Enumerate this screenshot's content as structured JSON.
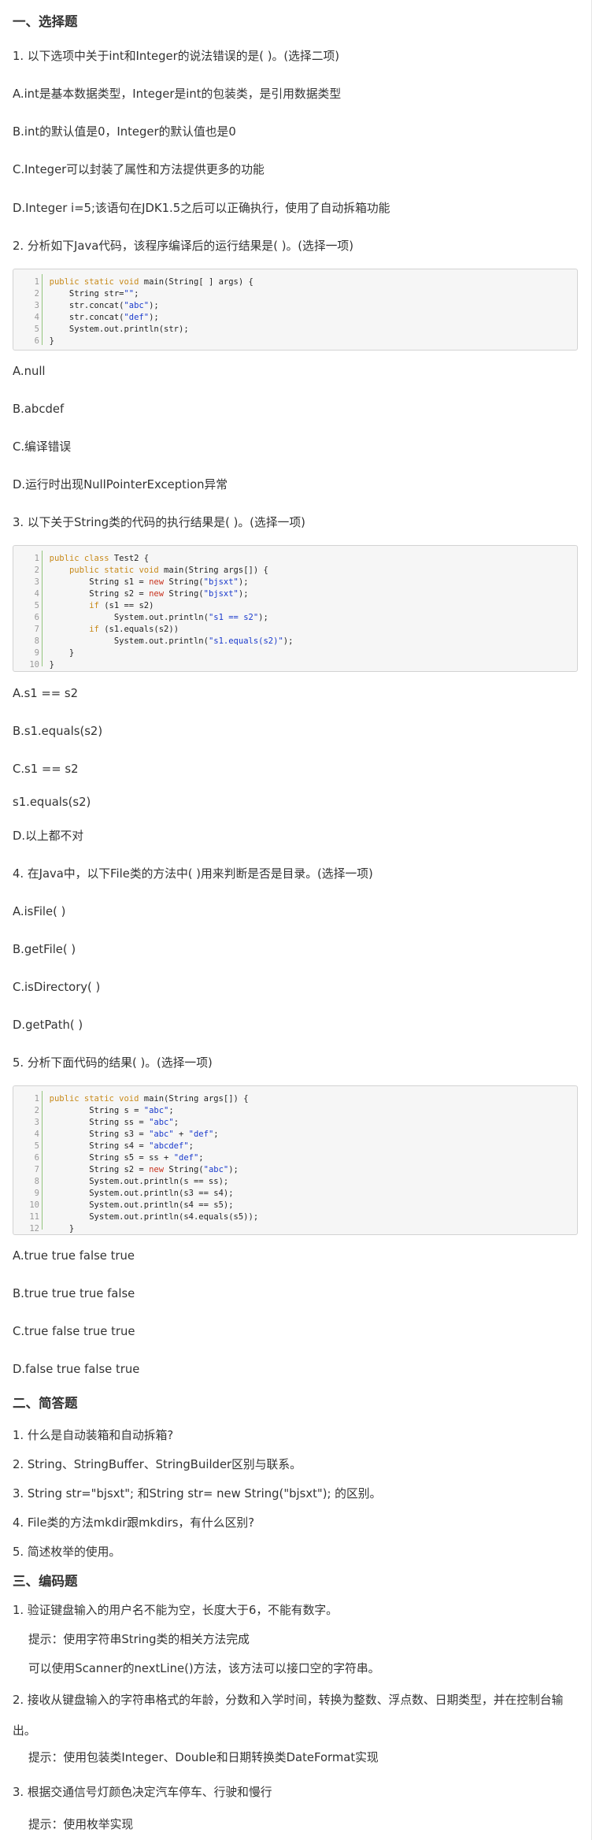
{
  "sections": {
    "s1": "一、选择题",
    "s2": "二、简答题",
    "s3": "三、编码题"
  },
  "q1": {
    "question": "1. 以下选项中关于int和Integer的说法错误的是( )。(选择二项)",
    "options": [
      "A.int是基本数据类型，Integer是int的包装类，是引用数据类型",
      "B.int的默认值是0，Integer的默认值也是0",
      "C.Integer可以封装了属性和方法提供更多的功能",
      "D.Integer i=5;该语句在JDK1.5之后可以正确执行，使用了自动拆箱功能"
    ]
  },
  "q2": {
    "question": "2. 分析如下Java代码，该程序编译后的运行结果是( )。(选择一项)",
    "code": [
      "public static void main(String[ ] args) {",
      "    String str=\"\";",
      "    str.concat(\"abc\");",
      "    str.concat(\"def\");",
      "    System.out.println(str);",
      "}"
    ],
    "options": [
      "A.null",
      "B.abcdef",
      "C.编译错误",
      "D.运行时出现NullPointerException异常"
    ]
  },
  "q3": {
    "question": "3. 以下关于String类的代码的执行结果是( )。(选择一项)",
    "code": [
      "public class Test2 {",
      "    public static void main(String args[]) {",
      "        String s1 = new String(\"bjsxt\");",
      "        String s2 = new String(\"bjsxt\");",
      "        if (s1 == s2)",
      "             System.out.println(\"s1 == s2\");",
      "        if (s1.equals(s2))",
      "             System.out.println(\"s1.equals(s2)\");",
      "    }",
      "}"
    ],
    "options": [
      "A.s1 == s2",
      "B.s1.equals(s2)",
      "C.s1 == s2",
      "   s1.equals(s2)",
      "D.以上都不对"
    ]
  },
  "q4": {
    "question": "4. 在Java中，以下File类的方法中( )用来判断是否是目录。(选择一项)",
    "options": [
      "A.isFile( )",
      "B.getFile( )",
      "C.isDirectory( )",
      "D.getPath( )"
    ]
  },
  "q5": {
    "question": "5. 分析下面代码的结果( )。(选择一项)",
    "code": [
      "public static void main(String args[]) {",
      "        String s = \"abc\";",
      "        String ss = \"abc\";",
      "        String s3 = \"abc\" + \"def\";",
      "        String s4 = \"abcdef\";",
      "        String s5 = ss + \"def\";",
      "        String s2 = new String(\"abc\");",
      "        System.out.println(s == ss);",
      "        System.out.println(s3 == s4);",
      "        System.out.println(s4 == s5);",
      "        System.out.println(s4.equals(s5));",
      "    }"
    ],
    "options": [
      "A.true true false true",
      "B.true true true false",
      "C.true false true true",
      "D.false true false true"
    ]
  },
  "short_answer": [
    "1. 什么是自动装箱和自动拆箱?",
    "2. String、StringBuffer、StringBuilder区别与联系。",
    "3. String str=\"bjsxt\"; 和String str= new String(\"bjsxt\"); 的区别。",
    "4. File类的方法mkdir跟mkdirs，有什么区别?",
    "5. 简述枚举的使用。"
  ],
  "coding": [
    "1. 验证键盘输入的用户名不能为空，长度大于6，不能有数字。",
    "提示：使用字符串String类的相关方法完成",
    "可以使用Scanner的nextLine()方法，该方法可以接口空的字符串。",
    "2. 接收从键盘输入的字符串格式的年龄，分数和入学时间，转换为整数、浮点数、日期类型，并在控制台输出。",
    "提示：使用包装类Integer、Double和日期转换类DateFormat实现",
    "3. 根据交通信号灯颜色决定汽车停车、行驶和慢行",
    "提示：使用枚举实现"
  ]
}
